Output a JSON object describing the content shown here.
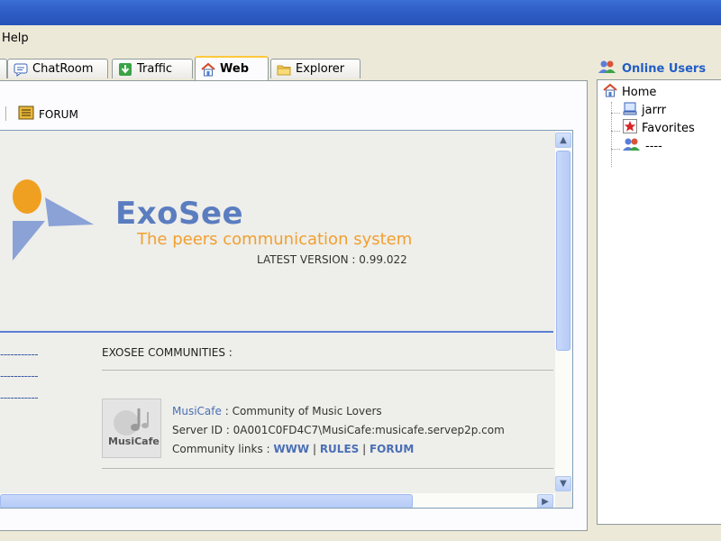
{
  "menu": {
    "help_label": "Help"
  },
  "tabs": [
    {
      "label": "ChatRoom",
      "icon": "chat-icon"
    },
    {
      "label": "Traffic",
      "icon": "download-arrow-icon"
    },
    {
      "label": "Web",
      "icon": "home-icon"
    },
    {
      "label": "Explorer",
      "icon": "folder-icon"
    }
  ],
  "toolbar": {
    "forum_label": "FORUM"
  },
  "page": {
    "brand_title": "ExoSee",
    "tagline": "The peers communication system",
    "version": "LATEST VERSION : 0.99.022",
    "communities_heading": "EXOSEE COMMUNITIES :",
    "dashes": "-----------",
    "community": {
      "logo_text": "MusiCafe",
      "name": "MusiCafe",
      "description": " : Community of Music Lovers",
      "server_id": "Server ID : 0A001C0FD4C7\\MusiCafe:musicafe.servep2p.com",
      "links_label": "Community links : ",
      "links": [
        "WWW",
        "RULES",
        "FORUM"
      ],
      "separator": " | "
    }
  },
  "online_users": {
    "title": "Online Users",
    "tree": {
      "root": "Home",
      "children": [
        "jarrr",
        "Favorites",
        "----"
      ]
    }
  },
  "colors": {
    "accent_blue": "#5a7dc0",
    "tagline_orange": "#f0a030",
    "tab_active_highlight": "#ffc83c",
    "link_blue": "#4a6fb5"
  }
}
